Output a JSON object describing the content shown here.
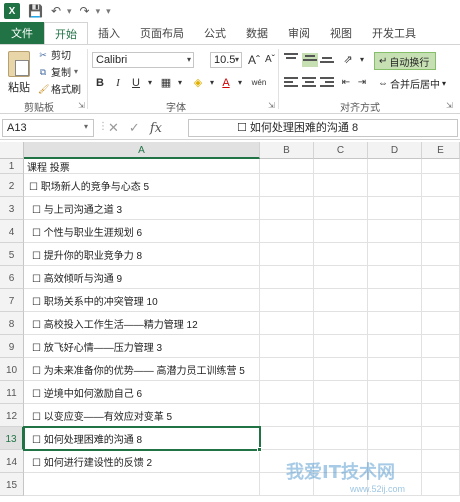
{
  "app": {
    "logo_text": "X"
  },
  "ribbon_tabs": [
    "文件",
    "开始",
    "插入",
    "页面布局",
    "公式",
    "数据",
    "审阅",
    "视图",
    "开发工具"
  ],
  "clipboard": {
    "paste": "粘贴",
    "cut": "剪切",
    "copy": "复制",
    "format_painter": "格式刷",
    "group_label": "剪贴板"
  },
  "font": {
    "name": "Calibri",
    "size": "10.5",
    "bold": "B",
    "italic": "I",
    "underline": "U",
    "font_color_glyph": "A",
    "phonetic": "wén",
    "group_label": "字体"
  },
  "alignment": {
    "wrap_text": "自动换行",
    "merge_center": "合并后居中",
    "group_label": "对齐方式"
  },
  "formula_bar": {
    "name_box": "A13",
    "fx": "fx",
    "value": "☐  如何处理困难的沟通 8"
  },
  "sheet": {
    "columns": [
      "A",
      "B",
      "C",
      "D",
      "E"
    ],
    "selected_column": "A",
    "selected_row": "13",
    "rows": [
      {
        "num": "1",
        "text": "课程  投票"
      },
      {
        "num": "2",
        "text": "☐ 职场新人的竞争与心态 5"
      },
      {
        "num": "3",
        "text": "☐ 与上司沟通之道 3"
      },
      {
        "num": "4",
        "text": "☐ 个性与职业生涯规划 6"
      },
      {
        "num": "5",
        "text": "☐ 提升你的职业竞争力 8"
      },
      {
        "num": "6",
        "text": "☐ 高效倾听与沟通 9"
      },
      {
        "num": "7",
        "text": "☐ 职场关系中的冲突管理 10"
      },
      {
        "num": "8",
        "text": "☐ 高校投入工作生活——精力管理 12"
      },
      {
        "num": "9",
        "text": "☐ 放飞好心情——压力管理 3"
      },
      {
        "num": "10",
        "text": "☐ 为未来准备你的优势—— 高潜力员工训练营 5"
      },
      {
        "num": "11",
        "text": "☐ 逆境中如何激励自己 6"
      },
      {
        "num": "12",
        "text": "☐ 以变应变——有效应对变革 5"
      },
      {
        "num": "13",
        "text": "☐ 如何处理困难的沟通 8"
      },
      {
        "num": "14",
        "text": "☐ 如何进行建设性的反馈 2"
      },
      {
        "num": "15",
        "text": ""
      }
    ]
  },
  "watermark": {
    "text": "我爱IT技术网",
    "sub": "www.52ij.com"
  },
  "colors": {
    "excel_green": "#217346",
    "wrap_highlight": "#c6e0b4"
  }
}
